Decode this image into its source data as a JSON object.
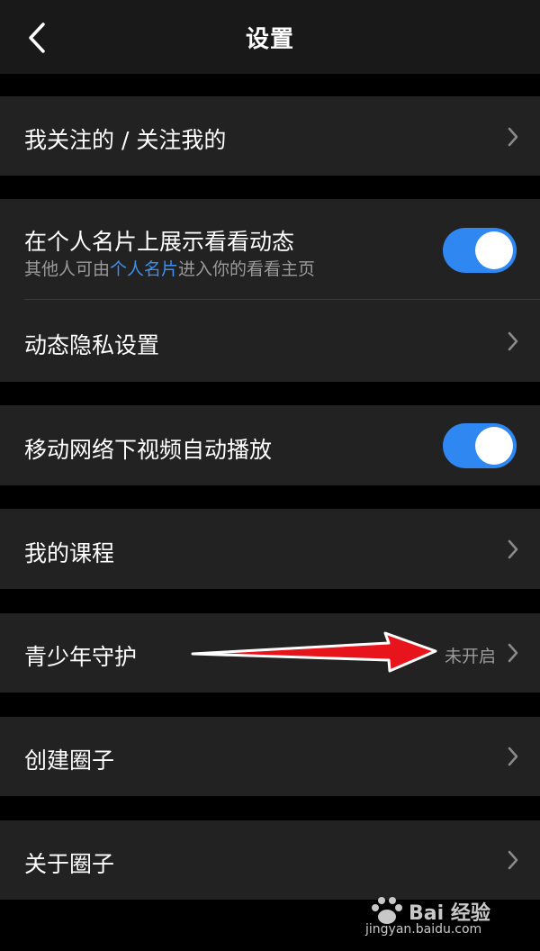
{
  "header": {
    "title": "设置",
    "back_icon": "chevron-left-icon"
  },
  "rows": {
    "follow": {
      "label": "我关注的 / 关注我的"
    },
    "show_moments": {
      "label": "在个人名片上展示看看动态",
      "sub_prefix": "其他人可由",
      "sub_link": "个人名片",
      "sub_suffix": "进入你的看看主页",
      "toggle_on": true
    },
    "privacy": {
      "label": "动态隐私设置"
    },
    "autoplay": {
      "label": "移动网络下视频自动播放",
      "toggle_on": true
    },
    "courses": {
      "label": "我的课程"
    },
    "youth": {
      "label": "青少年守护",
      "value": "未开启"
    },
    "create_circle": {
      "label": "创建圈子"
    },
    "about_circle": {
      "label": "关于圈子"
    }
  },
  "colors": {
    "background": "#000000",
    "card": "#222222",
    "toggle_on": "#2f87f2",
    "link": "#3d8ff0",
    "annotation_arrow": "#e8141c"
  },
  "watermark": {
    "brand": "Bai 经验",
    "url": "jingyan.baidu.com"
  }
}
